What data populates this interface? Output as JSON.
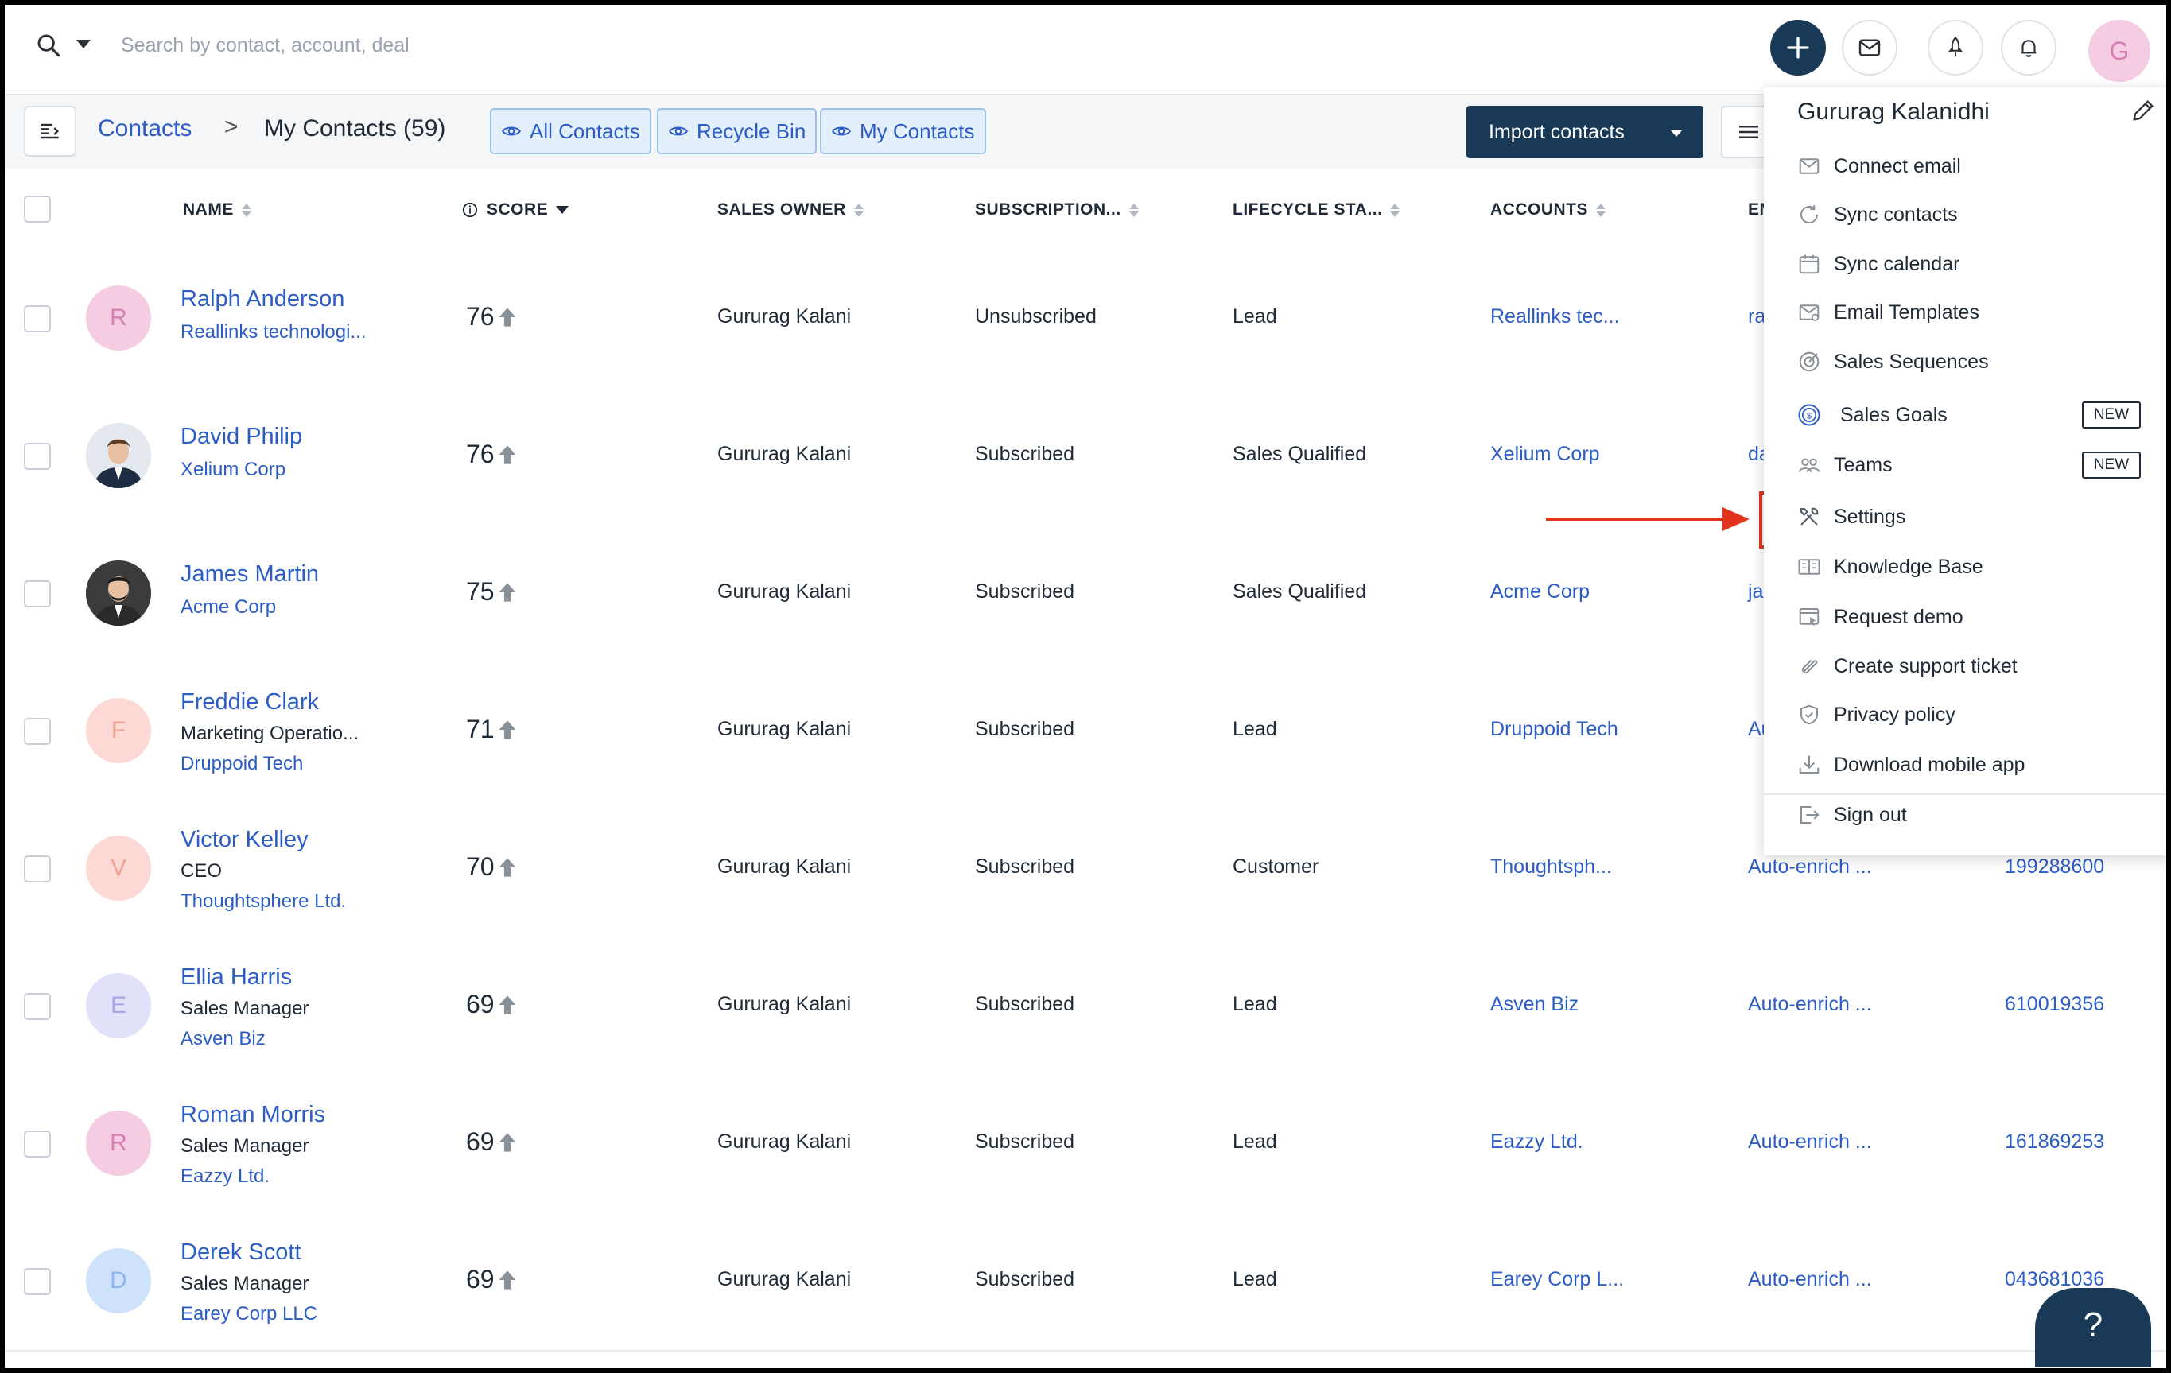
{
  "search": {
    "placeholder": "Search by contact, account, deal"
  },
  "user": {
    "avatar_letter": "G",
    "name": "Gururag Kalanidhi"
  },
  "breadcrumb": {
    "root": "Contacts",
    "separator": ">",
    "current": "My Contacts (59)"
  },
  "views": [
    {
      "label": "All Contacts"
    },
    {
      "label": "Recycle Bin"
    },
    {
      "label": "My Contacts"
    }
  ],
  "toolbar": {
    "import_label": "Import contacts"
  },
  "columns": [
    {
      "label": "NAME"
    },
    {
      "label": "SCORE"
    },
    {
      "label": "SALES OWNER"
    },
    {
      "label": "SUBSCRIPTION..."
    },
    {
      "label": "LIFECYCLE STA..."
    },
    {
      "label": "ACCOUNTS"
    },
    {
      "label": "EM"
    }
  ],
  "rows": [
    {
      "initial": "R",
      "avatar_color": "#f6cce3",
      "initial_color": "#d67fb0",
      "name": "Ralph Anderson",
      "title": "",
      "company": "Reallinks technologi...",
      "score": "76",
      "owner": "Gururag Kalani",
      "subscription": "Unsubscribed",
      "lifecycle": "Lead",
      "account": "Reallinks tec...",
      "email": "ra",
      "phone": ""
    },
    {
      "initial": "",
      "avatar_color": "#dfe6ee",
      "initial_color": "#444",
      "name": "David Philip",
      "title": "",
      "company": "Xelium Corp",
      "score": "76",
      "owner": "Gururag Kalani",
      "subscription": "Subscribed",
      "lifecycle": "Sales Qualified",
      "account": "Xelium Corp",
      "email": "da",
      "phone": ""
    },
    {
      "initial": "",
      "avatar_color": "#3a3a3a",
      "initial_color": "#fff",
      "name": "James Martin",
      "title": "",
      "company": "Acme Corp",
      "score": "75",
      "owner": "Gururag Kalani",
      "subscription": "Subscribed",
      "lifecycle": "Sales Qualified",
      "account": "Acme Corp",
      "email": "ja",
      "phone": ""
    },
    {
      "initial": "F",
      "avatar_color": "#fcd9d4",
      "initial_color": "#f2a193",
      "name": "Freddie Clark",
      "title": "Marketing Operatio...",
      "company": "Druppoid Tech",
      "score": "71",
      "owner": "Gururag Kalani",
      "subscription": "Subscribed",
      "lifecycle": "Lead",
      "account": "Druppoid Tech",
      "email": "Au",
      "phone": ""
    },
    {
      "initial": "V",
      "avatar_color": "#fcd9d4",
      "initial_color": "#f2a193",
      "name": "Victor Kelley",
      "title": "CEO",
      "company": "Thoughtsphere Ltd.",
      "score": "70",
      "owner": "Gururag Kalani",
      "subscription": "Subscribed",
      "lifecycle": "Customer",
      "account": "Thoughtsph...",
      "email": "Auto-enrich ...",
      "phone": "199288600"
    },
    {
      "initial": "E",
      "avatar_color": "#e1e1fa",
      "initial_color": "#a7a7e8",
      "name": "Ellia Harris",
      "title": "Sales Manager",
      "company": "Asven Biz",
      "score": "69",
      "owner": "Gururag Kalani",
      "subscription": "Subscribed",
      "lifecycle": "Lead",
      "account": "Asven Biz",
      "email": "Auto-enrich ...",
      "phone": "610019356"
    },
    {
      "initial": "R",
      "avatar_color": "#f6cce3",
      "initial_color": "#d67fb0",
      "name": "Roman Morris",
      "title": "Sales Manager",
      "company": "Eazzy Ltd.",
      "score": "69",
      "owner": "Gururag Kalani",
      "subscription": "Subscribed",
      "lifecycle": "Lead",
      "account": "Eazzy Ltd.",
      "email": "Auto-enrich ...",
      "phone": "161869253"
    },
    {
      "initial": "D",
      "avatar_color": "#cfe2fb",
      "initial_color": "#8cb6ee",
      "name": "Derek Scott",
      "title": "Sales Manager",
      "company": "Earey Corp LLC",
      "score": "69",
      "owner": "Gururag Kalani",
      "subscription": "Subscribed",
      "lifecycle": "Lead",
      "account": "Earey Corp L...",
      "email": "Auto-enrich ...",
      "phone": "043681036"
    }
  ],
  "menu": {
    "items": [
      {
        "label": "Connect email",
        "icon": "mail-icon"
      },
      {
        "label": "Sync contacts",
        "icon": "sync-icon"
      },
      {
        "label": "Sync calendar",
        "icon": "calendar-icon"
      },
      {
        "label": "Email Templates",
        "icon": "template-icon"
      },
      {
        "label": "Sales Sequences",
        "icon": "target-icon"
      },
      {
        "label": "Sales Goals",
        "icon": "goal-icon",
        "badge": "NEW"
      },
      {
        "label": "Teams",
        "icon": "teams-icon",
        "badge": "NEW"
      },
      {
        "label": "Settings",
        "icon": "settings-icon"
      },
      {
        "label": "Knowledge Base",
        "icon": "book-icon"
      },
      {
        "label": "Request demo",
        "icon": "demo-icon"
      },
      {
        "label": "Create support ticket",
        "icon": "ticket-icon"
      },
      {
        "label": "Privacy policy",
        "icon": "shield-icon"
      },
      {
        "label": "Download mobile app",
        "icon": "download-icon"
      },
      {
        "label": "Sign out",
        "icon": "signout-icon"
      }
    ]
  },
  "help": {
    "label": "?"
  },
  "colors": {
    "brand_dark": "#183a56",
    "link": "#2c5cc5",
    "highlight": "#e2341d"
  }
}
